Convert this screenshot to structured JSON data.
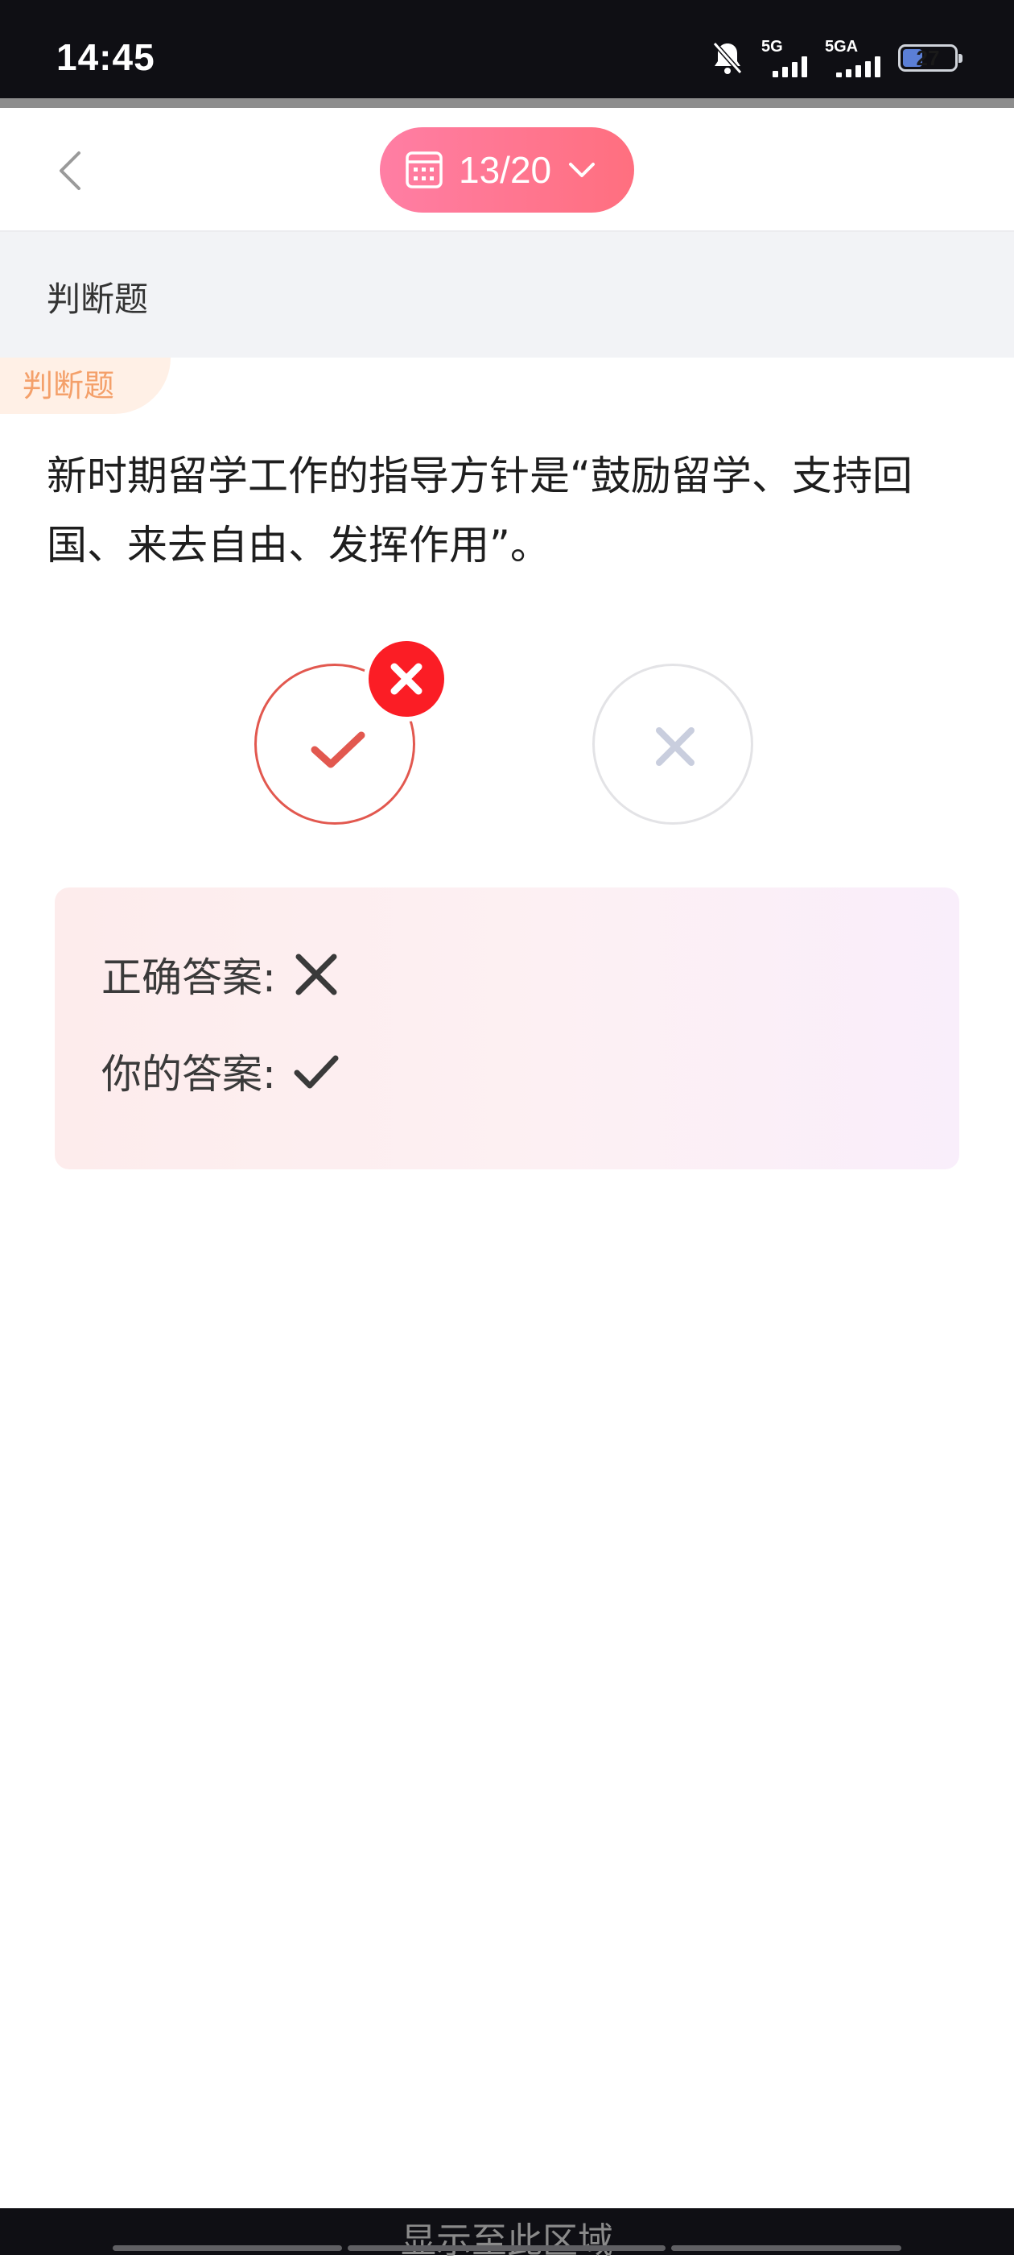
{
  "status_bar": {
    "time": "14:45",
    "signal1_label": "5G",
    "signal2_label": "5GA",
    "battery_level": "27",
    "icons": [
      "bell-muted-icon",
      "signal-icon",
      "signal-icon",
      "battery-icon"
    ]
  },
  "nav": {
    "back_icon": "chevron-left-icon",
    "progress_label": "13/20",
    "progress_icon": "calendar-grid-icon",
    "dropdown_icon": "chevron-down-icon"
  },
  "section": {
    "title": "判断题"
  },
  "question": {
    "type_tag": "判断题",
    "text": "新时期留学工作的指导方针是“鼓励留学、支持回国、来去自由、发挥作用”。",
    "options": [
      {
        "name": "true",
        "icon": "check-icon",
        "selected": true,
        "state": "wrong"
      },
      {
        "name": "false",
        "icon": "cross-icon",
        "selected": false
      }
    ],
    "wrong_badge_icon": "cross-icon"
  },
  "answers": {
    "correct_label": "正确答案:",
    "correct_icon": "cross-icon",
    "yours_label": "你的答案:",
    "yours_icon": "check-icon"
  },
  "bottom": {
    "label": "显示至此区域"
  },
  "colors": {
    "accent_pink": "#ff7ea4",
    "wrong_red": "#fb1d25",
    "tag_orange": "#f4a06a"
  }
}
